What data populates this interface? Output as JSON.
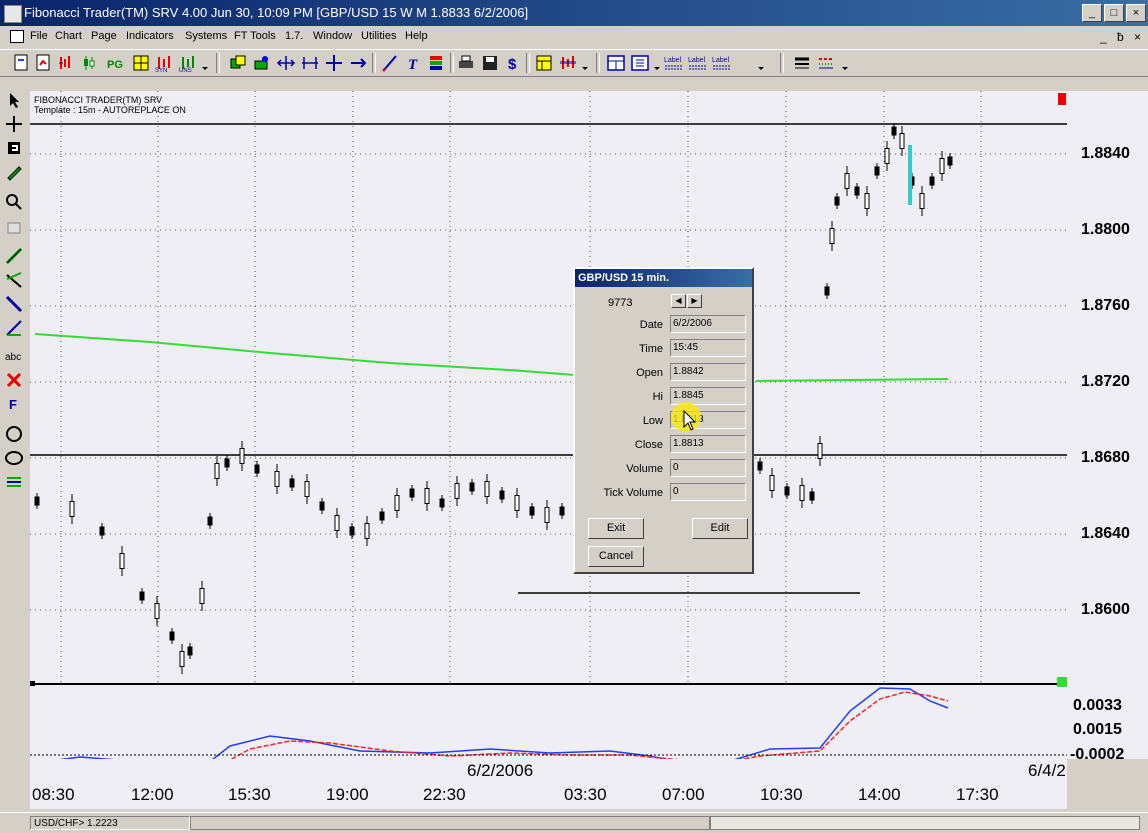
{
  "window": {
    "title": "Fibonacci Trader(TM) SRV 4.00 Jun 30, 10:09 PM   [GBP/USD 15  W  M 1.8833 6/2/2006]",
    "minimize": "_",
    "maximize": "□",
    "close": "×"
  },
  "menu": [
    "File",
    "Chart",
    "Page",
    "Indicators",
    "Systems",
    "FT Tools",
    "1.7.",
    "Window",
    "Utilities",
    "Help"
  ],
  "mdi": {
    "minimize": "_",
    "restore": "ƀ",
    "close": "×"
  },
  "toolbar": {
    "label1": "Label",
    "label2": "Label",
    "label3": "Label"
  },
  "chart": {
    "header_line1": "FIBONACCI TRADER(TM) SRV",
    "header_line2": "Template : 15m - AUTOREPLACE ON",
    "price_labels": [
      "1.8840",
      "1.8800",
      "1.8760",
      "1.8720",
      "1.8680",
      "1.8640",
      "1.8600"
    ],
    "osc_labels": [
      "0.0033",
      "0.0015",
      "-0.0002"
    ],
    "time_labels": [
      "08:30",
      "12:00",
      "15:30",
      "19:00",
      "22:30",
      "03:30",
      "07:00",
      "10:30",
      "14:00",
      "17:30"
    ],
    "date_labels": [
      "6/2/2006",
      "6/4/2"
    ],
    "colors": {
      "background": "#f0eef5",
      "candles": "#000000",
      "ma_line": "#33dd33",
      "osc_blue": "#1f3cff",
      "osc_red": "#ff2020",
      "highlight_bar": "#33cccc"
    }
  },
  "dialog": {
    "title": "GBP/USD  15 min.",
    "record": "9773",
    "fields": [
      {
        "label": "Date",
        "value": "6/2/2006"
      },
      {
        "label": "Time",
        "value": "15:45"
      },
      {
        "label": "Open",
        "value": "1.8842"
      },
      {
        "label": "Hi",
        "value": "1.8845"
      },
      {
        "label": "Low",
        "value": "1.8813"
      },
      {
        "label": "Close",
        "value": "1.8813"
      },
      {
        "label": "Volume",
        "value": "0"
      },
      {
        "label": "Tick Volume",
        "value": "0"
      }
    ],
    "exit_label": "Exit",
    "edit_label": "Edit",
    "cancel_label": "Cancel"
  },
  "status": {
    "symbol": "USD/CHF> 1.2223"
  }
}
